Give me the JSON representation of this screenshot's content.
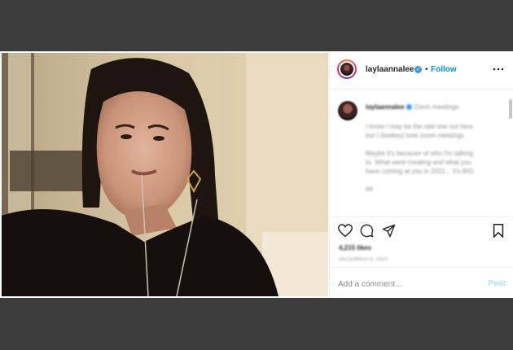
{
  "post": {
    "username": "laylaannalee",
    "follow_label": "Follow",
    "separator": "•",
    "caption_header": "Zoom meetings",
    "caption_lines": [
      "I know I may be the odd one out here",
      "but I (lowkey) love zoom meetings",
      "",
      "Maybe it's because of who I'm talking",
      "to. What were creating and what you",
      "have coming at you in 2021... It's BIG"
    ],
    "caption_tail": "##",
    "likes": "4,215 likes",
    "date": "DECEMBER 6, 2020",
    "comment_placeholder": "Add a comment...",
    "post_label": "Post"
  },
  "colors": {
    "link": "#0095f6",
    "post_disabled": "#b2dffc",
    "verified": "#3897f0"
  }
}
